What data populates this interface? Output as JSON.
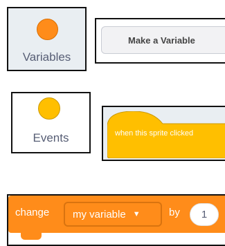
{
  "categories": {
    "variables": {
      "label": "Variables",
      "color": "#ff8c1a"
    },
    "events": {
      "label": "Events",
      "color": "#ffbf00"
    }
  },
  "make_variable_button": {
    "label": "Make a Variable"
  },
  "event_block": {
    "label": "when this sprite clicked",
    "color": "#ffbf00"
  },
  "change_block": {
    "verb": "change",
    "variable": "my variable",
    "dropdown_icon": "caret-down-icon",
    "preposition": "by",
    "amount": "1",
    "color": "#ff8c1a"
  }
}
